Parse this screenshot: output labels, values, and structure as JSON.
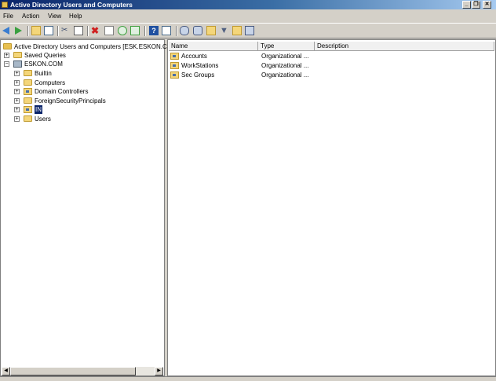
{
  "window": {
    "title": "Active Directory Users and Computers",
    "controls": [
      "minimize-icon",
      "restore-icon",
      "close-icon"
    ]
  },
  "menu": {
    "items": [
      "File",
      "Action",
      "View",
      "Help"
    ]
  },
  "toolbar": {
    "icons": [
      "back-arrow-icon",
      "forward-arrow-icon",
      "up-folder-icon",
      "show-hide-tree-icon",
      "cut-icon",
      "copy-icon",
      "delete-icon",
      "properties-icon",
      "refresh-icon",
      "export-list-icon",
      "help-icon",
      "view-icon",
      "new-user-icon",
      "new-group-icon",
      "new-ou-icon",
      "filter-icon",
      "find-icon",
      "delegate-icon"
    ]
  },
  "tree": {
    "root": "Active Directory Users and Computers [ESK.ESKON.COM",
    "items": [
      {
        "label": "Saved Queries",
        "expander": "+"
      },
      {
        "label": "ESKON.COM",
        "expander": "−"
      },
      {
        "label": "Builtin",
        "expander": "+"
      },
      {
        "label": "Computers",
        "expander": "+"
      },
      {
        "label": "Domain Controllers",
        "expander": "+"
      },
      {
        "label": "ForeignSecurityPrincipals",
        "expander": "+"
      },
      {
        "label": "IN",
        "expander": "+"
      },
      {
        "label": "Users",
        "expander": "+"
      }
    ]
  },
  "list": {
    "columns": [
      "Name",
      "Type",
      "Description"
    ],
    "rows": [
      {
        "name": "Accounts",
        "type": "Organizational ...",
        "description": ""
      },
      {
        "name": "WorkStations",
        "type": "Organizational ...",
        "description": ""
      },
      {
        "name": "Sec Groups",
        "type": "Organizational ...",
        "description": ""
      }
    ]
  },
  "scroll": {
    "left": "◀",
    "right": "▶"
  },
  "colors": {
    "title_start": "#0a246a",
    "title_end": "#a6caf0",
    "selection": "#0a246a",
    "folder": "#f4d67a"
  }
}
